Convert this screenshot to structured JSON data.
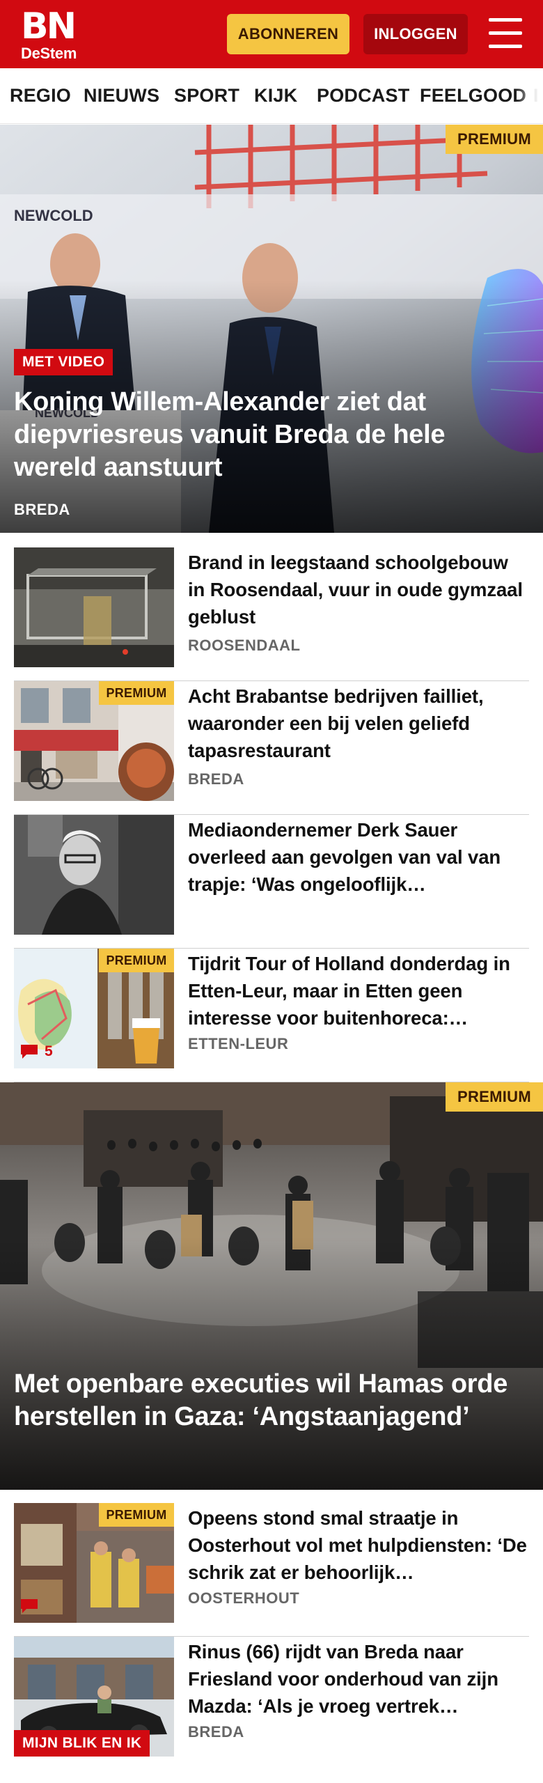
{
  "header": {
    "logo_top": "BN",
    "logo_bottom": "DeStem",
    "subscribe_label": "ABONNEREN",
    "login_label": "INLOGGEN",
    "menu_icon": "hamburger-menu-icon",
    "brand_color": "#d10a11",
    "accent_color": "#f5c542"
  },
  "nav": {
    "items": [
      "REGIO",
      "NIEUWS",
      "SPORT",
      "KIJK",
      "PODCAST",
      "FEELGOOD"
    ]
  },
  "hero1": {
    "premium": "PREMIUM",
    "tag": "MET VIDEO",
    "title": "Koning Willem-Alexander ziet dat diepvriesreus vanuit Breda de hele wereld aanstuurt",
    "location": "BREDA",
    "image_text": [
      "NEWCOLD",
      "NEWCOLD"
    ]
  },
  "articles1": [
    {
      "title": "Brand in leegstaand schoolge­bouw in Roosendaal, vuur in oude gymzaal geblust",
      "location": "ROOSENDAAL"
    },
    {
      "premium": "PREMIUM",
      "title": "Acht Brabantse bedrijven failliet, waaronder een bij velen geliefd tapasrestaurant",
      "location": "BREDA"
    },
    {
      "title": "Mediaondernemer Derk Sauer overleed aan gevolgen van val van trapje: ‘Was ongelooflijk…",
      "location": ""
    },
    {
      "premium": "PREMIUM",
      "title": "Tijdrit Tour of Holland donderdag in Etten-Leur, maar in Etten geen interesse voor buitenhoreca:…",
      "location": "ETTEN-LEUR",
      "comments": "5"
    }
  ],
  "hero2": {
    "premium": "PREMIUM",
    "title": "Met openbare executies wil Hamas orde herstellen in Gaza: ‘Angstaanja­gend’"
  },
  "articles2": [
    {
      "premium": "PREMIUM",
      "title": "Opeens stond smal straatje in Oosterhout vol met hulpdien­sten: ‘De schrik zat er behoorlijk…",
      "location": "OOSTERHOUT"
    },
    {
      "tag": "MIJN BLIK EN IK",
      "title": "Rinus (66) rijdt van Breda naar Friesland voor onderhoud van zijn Mazda: ‘Als je vroeg vertrek…",
      "location": "BREDA"
    }
  ]
}
